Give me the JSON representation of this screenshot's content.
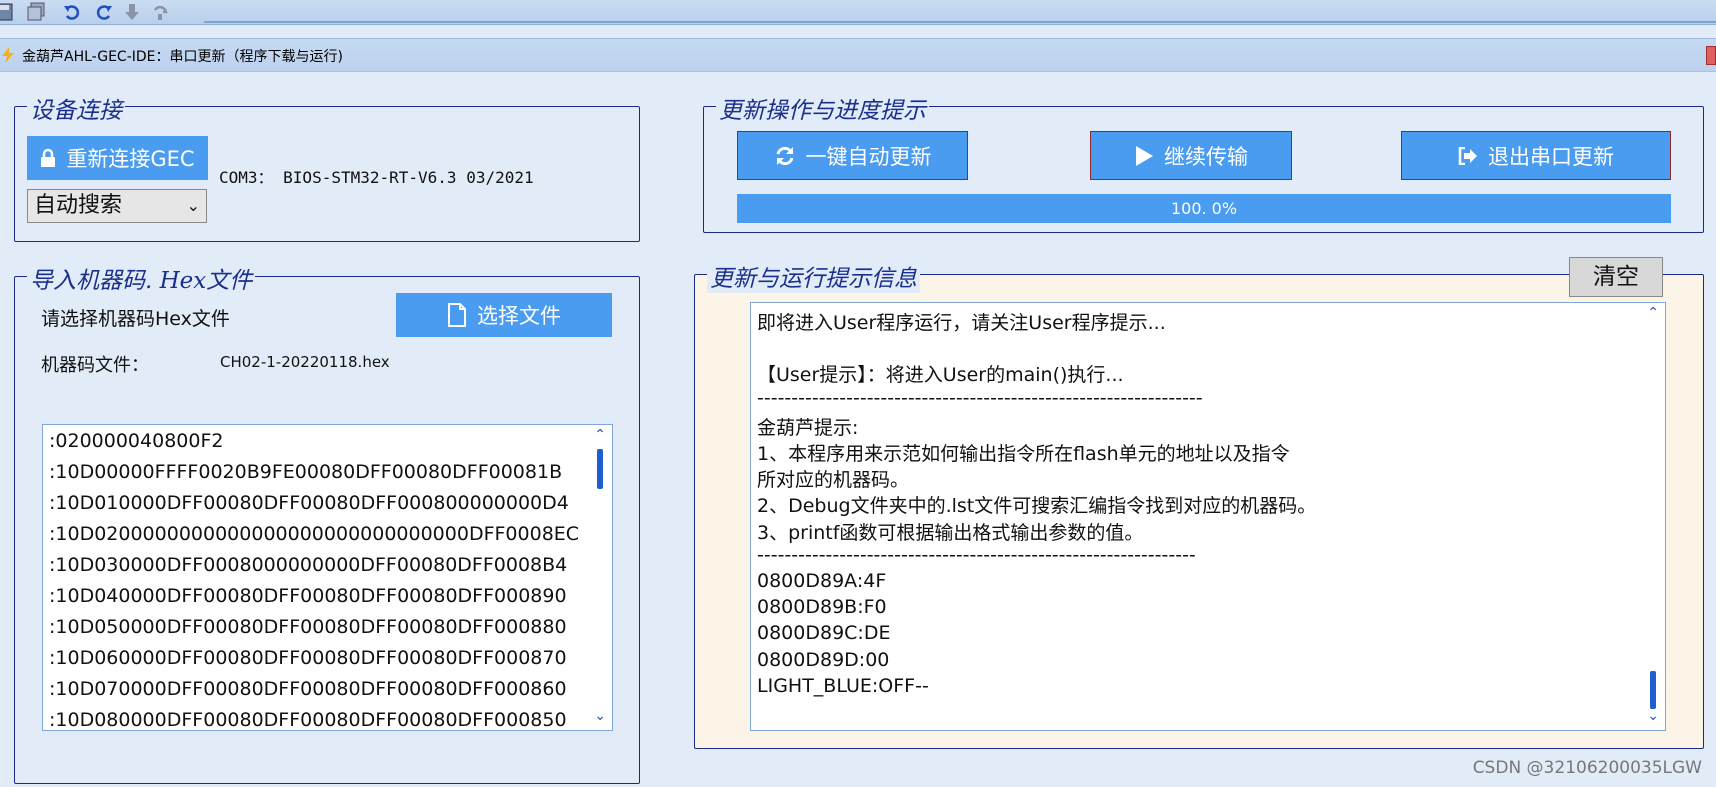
{
  "window": {
    "title": "金葫芦AHL-GEC-IDE：串口更新（程序下载与运行)"
  },
  "toolbar_icons": [
    "save-icon",
    "save-all-icon",
    "undo-icon",
    "redo-icon",
    "step-down-icon",
    "step-back-icon"
  ],
  "device": {
    "group_title": "设备连接",
    "reconnect_label": "重新连接GEC",
    "port_info": "COM3：  BIOS-STM32-RT-V6.3 03/2021",
    "search_mode": "自动搜索"
  },
  "update": {
    "group_title": "更新操作与进度提示",
    "auto_update_label": "一键自动更新",
    "continue_label": "继续传输",
    "exit_label": "退出串口更新",
    "progress_text": "100. 0%",
    "progress": 1.0
  },
  "hex": {
    "group_title": "导入机器码. Hex文件",
    "prompt": "请选择机器码Hex文件",
    "choose_label": "选择文件",
    "file_label": "机器码文件：",
    "file_name": "CH02-1-20220118.hex",
    "lines": [
      ":020000040800F2",
      ":10D00000FFFF0020B9FE00080DFF00080DFF00081B",
      ":10D010000DFF00080DFF00080DFF000800000000D4",
      ":10D0200000000000000000000000000000DFF0008EC",
      ":10D030000DFF0008000000000DFF00080DFF0008B4",
      ":10D040000DFF00080DFF00080DFF00080DFF000890",
      ":10D050000DFF00080DFF00080DFF00080DFF000880",
      ":10D060000DFF00080DFF00080DFF00080DFF000870",
      ":10D070000DFF00080DFF00080DFF00080DFF000860",
      ":10D080000DFF00080DFF00080DFF00080DFF000850"
    ]
  },
  "log": {
    "group_title": "更新与运行提示信息",
    "clear_label": "清空",
    "lines": [
      "      即将进入User程序运行，请关注User程序提示...",
      "",
      "【User提示】：将进入User的main()执行...",
      "-----------------------------------------------------------------",
      "金葫芦提示:",
      "1、本程序用来示范如何输出指令所在flash单元的地址以及指令",
      "所对应的机器码。",
      "2、Debug文件夹中的.lst文件可搜索汇编指令找到对应的机器码。",
      "3、printf函数可根据输出格式输出参数的值。",
      "----------------------------------------------------------------",
      "0800D89A:4F",
      "0800D89B:F0",
      "0800D89C:DE",
      "0800D89D:00",
      "LIGHT_BLUE:OFF--"
    ]
  },
  "watermark": "CSDN @32106200035LGW"
}
